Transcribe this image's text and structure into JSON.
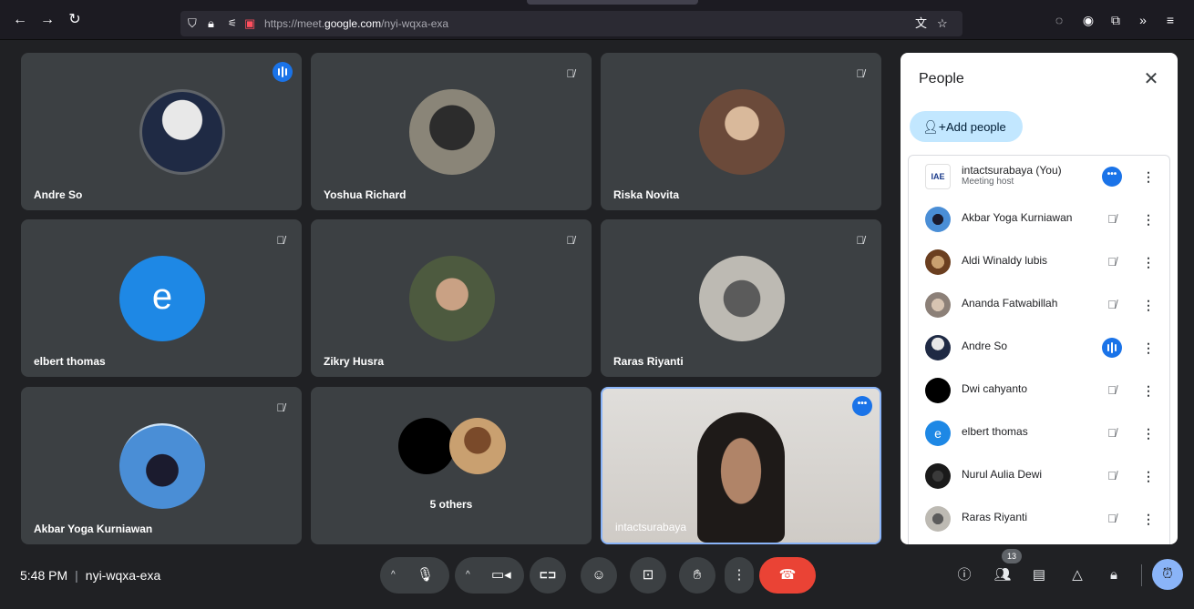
{
  "browser": {
    "url_prefix": "https://meet.",
    "url_domain": "google.com",
    "url_path": "/nyi-wqxa-exa",
    "icons": [
      "back-arrow",
      "forward-arrow",
      "reload",
      "shield",
      "lock",
      "permissions",
      "camera-blocked",
      "translate",
      "bookmark-star",
      "pocket",
      "account",
      "extensions",
      "overflow",
      "menu"
    ]
  },
  "tiles": [
    {
      "name": "Andre So",
      "status": "speaking"
    },
    {
      "name": "Yoshua Richard",
      "status": "muted"
    },
    {
      "name": "Riska Novita",
      "status": "muted"
    },
    {
      "name": "elbert thomas",
      "status": "muted",
      "initial": "e"
    },
    {
      "name": "Zikry Husra",
      "status": "muted"
    },
    {
      "name": "Raras Riyanti",
      "status": "muted"
    },
    {
      "name": "Akbar Yoga Kurniawan",
      "status": "muted"
    },
    {
      "name": "5 others",
      "status": "group"
    },
    {
      "name": "intactsurabaya",
      "status": "self"
    }
  ],
  "people_panel": {
    "title": "People",
    "add_people_label": "Add people",
    "participants": [
      {
        "name": "intactsurabaya (You)",
        "subtitle": "Meeting host",
        "status": "more"
      },
      {
        "name": "Akbar Yoga Kurniawan",
        "status": "muted"
      },
      {
        "name": "Aldi Winaldy lubis",
        "status": "muted"
      },
      {
        "name": "Ananda Fatwabillah",
        "status": "muted"
      },
      {
        "name": "Andre So",
        "status": "speaking"
      },
      {
        "name": "Dwi cahyanto",
        "status": "muted"
      },
      {
        "name": "elbert thomas",
        "status": "muted",
        "initial": "e"
      },
      {
        "name": "Nurul Aulia Dewi",
        "status": "muted"
      },
      {
        "name": "Raras Riyanti",
        "status": "muted"
      }
    ]
  },
  "bottom_bar": {
    "time": "5:48 PM",
    "meeting_code": "nyi-wqxa-exa",
    "participant_count": "13"
  },
  "colors": {
    "accent_blue": "#1a73e8",
    "end_call_red": "#ea4335",
    "tile_bg": "#3c4043"
  }
}
